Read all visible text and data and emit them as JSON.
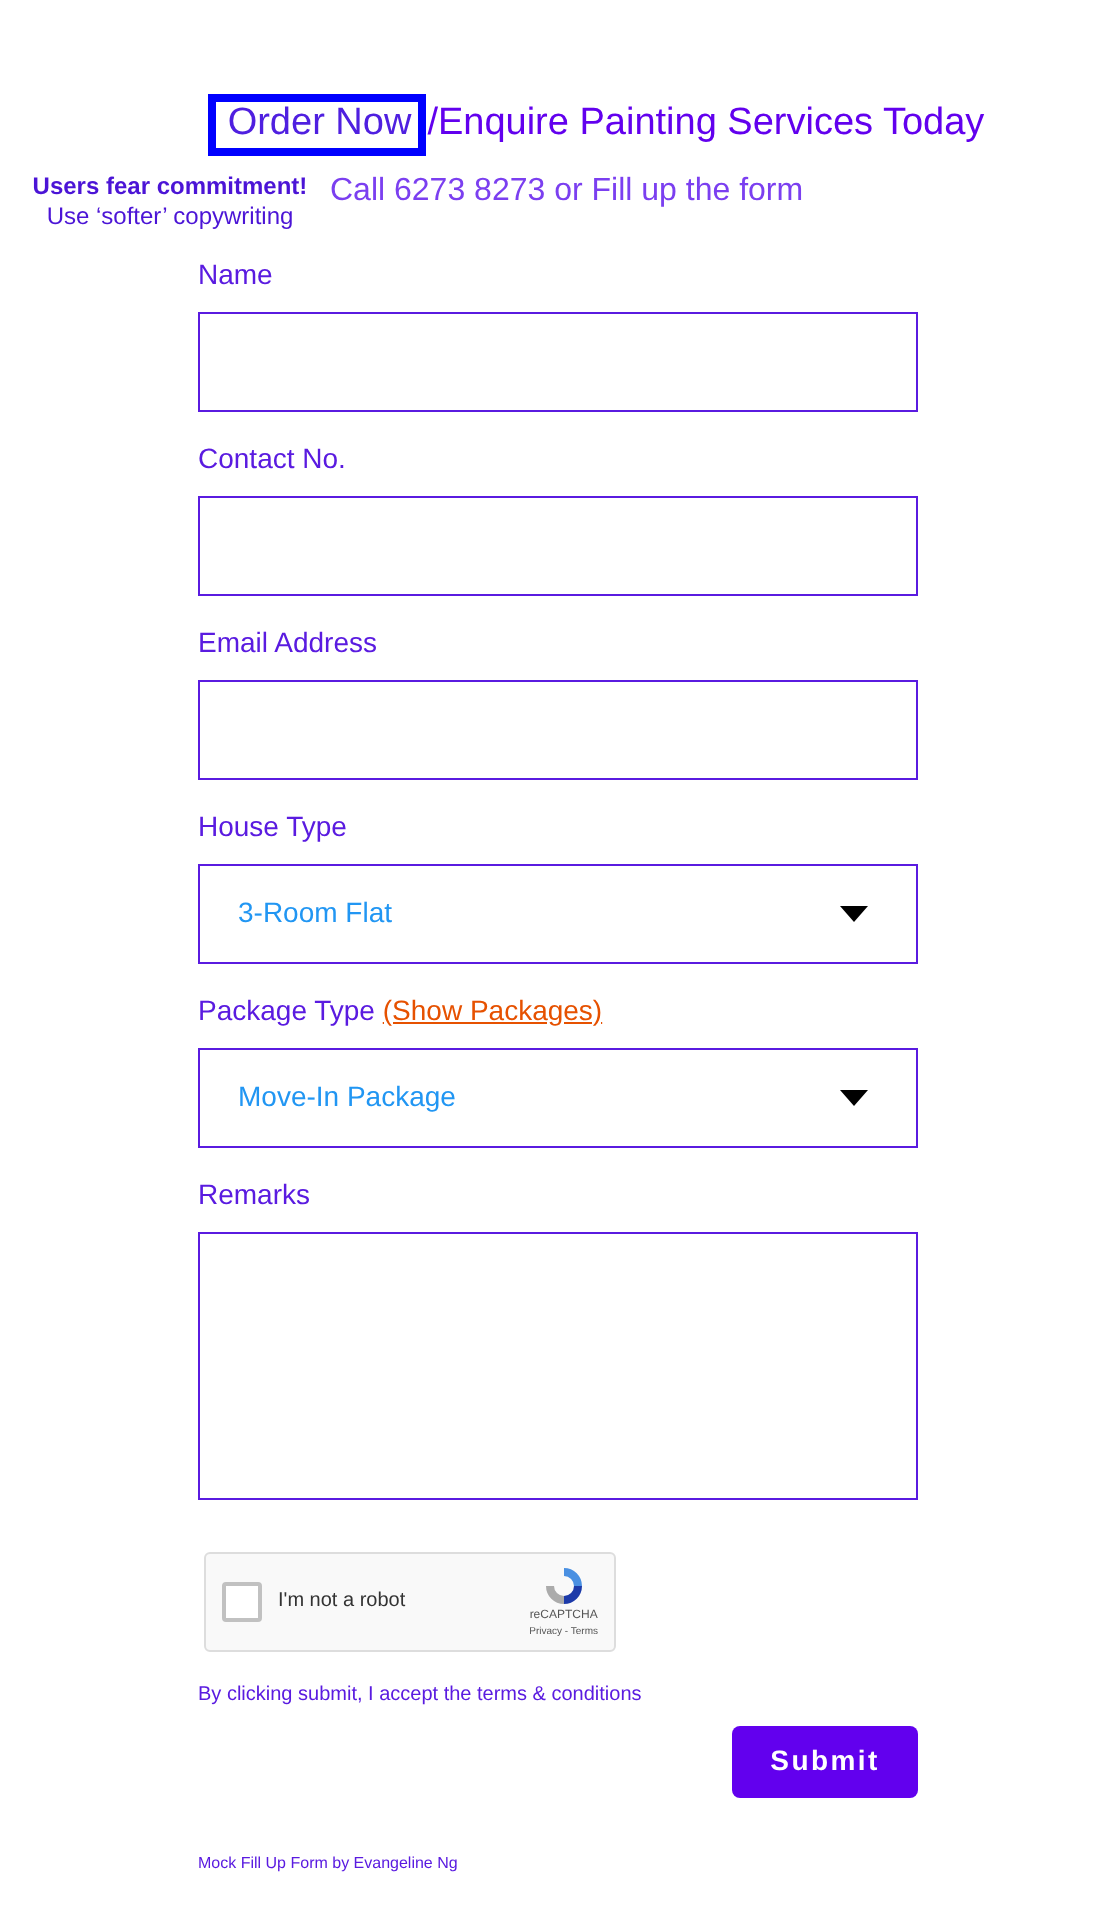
{
  "heading": {
    "highlighted": "Order Now",
    "rest": "/Enquire Painting Services Today"
  },
  "annotation": {
    "title": "Users fear commitment!",
    "note": "Use ‘softer’ copywriting"
  },
  "subtitle": "Call 6273 8273 or Fill up the form",
  "fields": [
    {
      "kind": "text",
      "label": "Name"
    },
    {
      "kind": "text",
      "label": "Contact No."
    },
    {
      "kind": "text",
      "label": "Email Address"
    },
    {
      "kind": "select",
      "label": "House Type",
      "value": "3-Room Flat"
    },
    {
      "kind": "select",
      "label": "Package Type",
      "link": "(Show Packages)",
      "value": "Move-In Package"
    },
    {
      "kind": "textarea",
      "label": "Remarks"
    }
  ],
  "captcha": {
    "label": "I'm not a robot",
    "checked": false,
    "brand": "reCAPTCHA",
    "links": "Privacy - Terms"
  },
  "terms": "By clicking submit, I accept the terms & conditions",
  "submit": "Submit",
  "footer": "Mock Fill Up Form by Evangeline Ng"
}
